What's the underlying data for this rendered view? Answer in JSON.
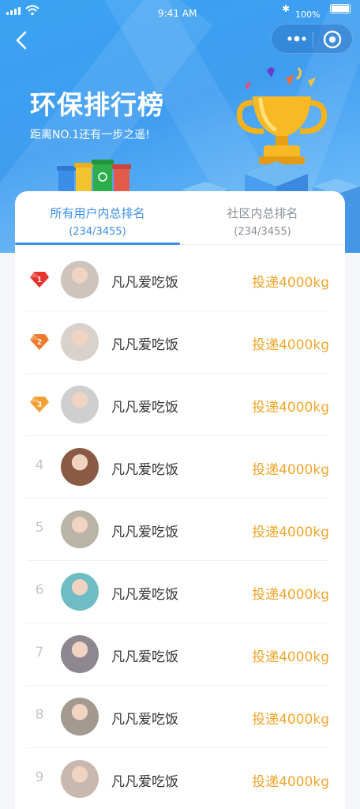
{
  "status_bar": {
    "time": "9:41 AM",
    "battery": "100%"
  },
  "header": {
    "title": "环保排行榜",
    "subtitle": "距离NO.1还有一步之遥!"
  },
  "tabs": [
    {
      "label": "所有用户内总排名",
      "count": "(234/3455)",
      "active": true
    },
    {
      "label": "社区内总排名",
      "count": "(234/3455)",
      "active": false
    }
  ],
  "colors": {
    "accent": "#3a8ee8",
    "amount": "#f2a62c",
    "hero": "#3f9df0"
  },
  "ranking": [
    {
      "rank": "1",
      "name": "凡凡爱吃饭",
      "amount": "投递4000kg",
      "medal": "1",
      "medal_color": "#e8332c",
      "avatar_bg": "#cfc3bd"
    },
    {
      "rank": "2",
      "name": "凡凡爱吃饭",
      "amount": "投递4000kg",
      "medal": "2",
      "medal_color": "#ef7b2a",
      "avatar_bg": "#d9d2cc"
    },
    {
      "rank": "3",
      "name": "凡凡爱吃饭",
      "amount": "投递4000kg",
      "medal": "3",
      "medal_color": "#f3a032",
      "avatar_bg": "#cfcfcf"
    },
    {
      "rank": "4",
      "name": "凡凡爱吃饭",
      "amount": "投递4000kg",
      "avatar_bg": "#8b5a44"
    },
    {
      "rank": "5",
      "name": "凡凡爱吃饭",
      "amount": "投递4000kg",
      "avatar_bg": "#b9b4a6"
    },
    {
      "rank": "6",
      "name": "凡凡爱吃饭",
      "amount": "投递4000kg",
      "avatar_bg": "#6fbcc4"
    },
    {
      "rank": "7",
      "name": "凡凡爱吃饭",
      "amount": "投递4000kg",
      "avatar_bg": "#8d8790"
    },
    {
      "rank": "8",
      "name": "凡凡爱吃饭",
      "amount": "投递4000kg",
      "avatar_bg": "#a39a8f"
    },
    {
      "rank": "9",
      "name": "凡凡爱吃饭",
      "amount": "投递4000kg",
      "avatar_bg": "#c9b8ae"
    }
  ]
}
